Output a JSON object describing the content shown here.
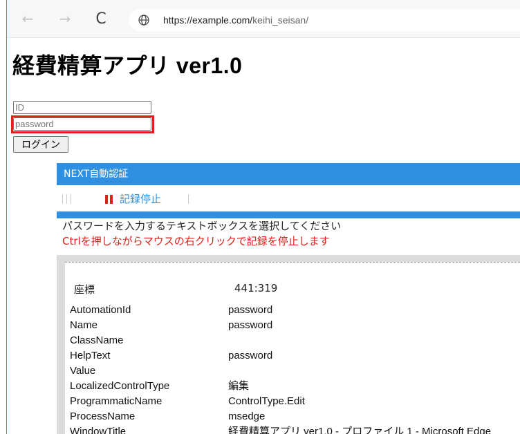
{
  "browser": {
    "url_host": "https://example.com/",
    "url_path": "keihi_seisan/",
    "back_icon": "←",
    "forward_icon": "→",
    "reload_icon": "C"
  },
  "app": {
    "title": "経費精算アプリ ver1.0",
    "id_placeholder": "ID",
    "password_placeholder": "password",
    "login_label": "ログイン"
  },
  "panel": {
    "header": "NEXT自動認証",
    "stop_label": "記録停止",
    "instruction_line1": "パスワードを入力するテキストボックスを選択してください",
    "instruction_line2": "Ctrlを押しながらマウスの右クリックで記録を停止します",
    "coord_label": "座標",
    "coord_value": "441:319",
    "properties": [
      {
        "name": "AutomationId",
        "value": "password"
      },
      {
        "name": "Name",
        "value": "password"
      },
      {
        "name": "ClassName",
        "value": ""
      },
      {
        "name": "HelpText",
        "value": "password"
      },
      {
        "name": "Value",
        "value": ""
      },
      {
        "name": "LocalizedControlType",
        "value": "編集"
      },
      {
        "name": "ProgrammaticName",
        "value": "ControlType.Edit"
      },
      {
        "name": "ProcessName",
        "value": "msedge"
      },
      {
        "name": "WindowTitle",
        "value": "経費精算アプリ ver1.0 - プロファイル 1 - Microsoft Edge"
      }
    ]
  },
  "colors": {
    "accent_blue": "#2f8fe0",
    "highlight_red": "#e0201a"
  }
}
